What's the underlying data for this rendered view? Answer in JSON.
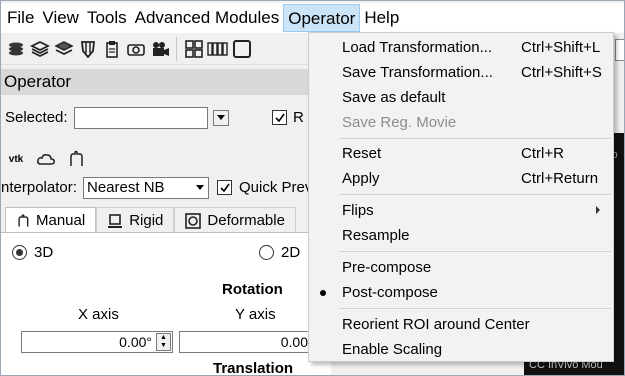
{
  "menubar": {
    "items": [
      "File",
      "View",
      "Tools",
      "Advanced Modules",
      "Operator",
      "Help"
    ],
    "active": "Operator"
  },
  "toolbar": {
    "icons": [
      "layers-icon",
      "layers-icon",
      "layers-icon",
      "shield-icon",
      "clipboard-icon",
      "camera-icon",
      "video-icon",
      "grid-icon",
      "columns-icon",
      "square-icon"
    ]
  },
  "operator_panel": {
    "title": "Operator",
    "selected_label": "Selected:",
    "selected_value": "",
    "checkbox_partial": "R",
    "vtk_label": "vtk",
    "interpolator_label": "nterpolator:",
    "interpolator_value": "Nearest NB",
    "quick_preview_label": "Quick Prev",
    "tabs": [
      "Manual",
      "Rigid",
      "Deformable"
    ],
    "radio_3d": "3D",
    "radio_2d": "2D",
    "rotation_label": "Rotation",
    "x_axis_label": "X axis",
    "y_axis_label": "Y axis",
    "x_value": "0.00°",
    "y_value": "0.00",
    "translation_label": "Translation"
  },
  "background_text": {
    "lower_right": "CC InVivo Mou",
    "side": "ib"
  },
  "dropdown": {
    "items": [
      {
        "label": "Load Transformation...",
        "shortcut": "Ctrl+Shift+L"
      },
      {
        "label": "Save Transformation...",
        "shortcut": "Ctrl+Shift+S"
      },
      {
        "label": "Save as default",
        "shortcut": ""
      },
      {
        "label": "Save Reg. Movie",
        "shortcut": "",
        "disabled": true
      },
      {
        "label": "Reset",
        "shortcut": "Ctrl+R"
      },
      {
        "label": "Apply",
        "shortcut": "Ctrl+Return"
      },
      {
        "label": "Flips",
        "shortcut": "",
        "submenu": true
      },
      {
        "label": "Resample",
        "shortcut": ""
      },
      {
        "label": "Pre-compose",
        "shortcut": ""
      },
      {
        "label": "Post-compose",
        "shortcut": "",
        "checked": true
      },
      {
        "label": "Reorient ROI around Center",
        "shortcut": ""
      },
      {
        "label": "Enable Scaling",
        "shortcut": ""
      }
    ]
  },
  "colors": {
    "menu_highlight": "#cce4f7",
    "menu_highlight_border": "#99c9ef",
    "dropdown_bg": "#f2f2f2",
    "disabled_text": "#8c8c8c"
  }
}
